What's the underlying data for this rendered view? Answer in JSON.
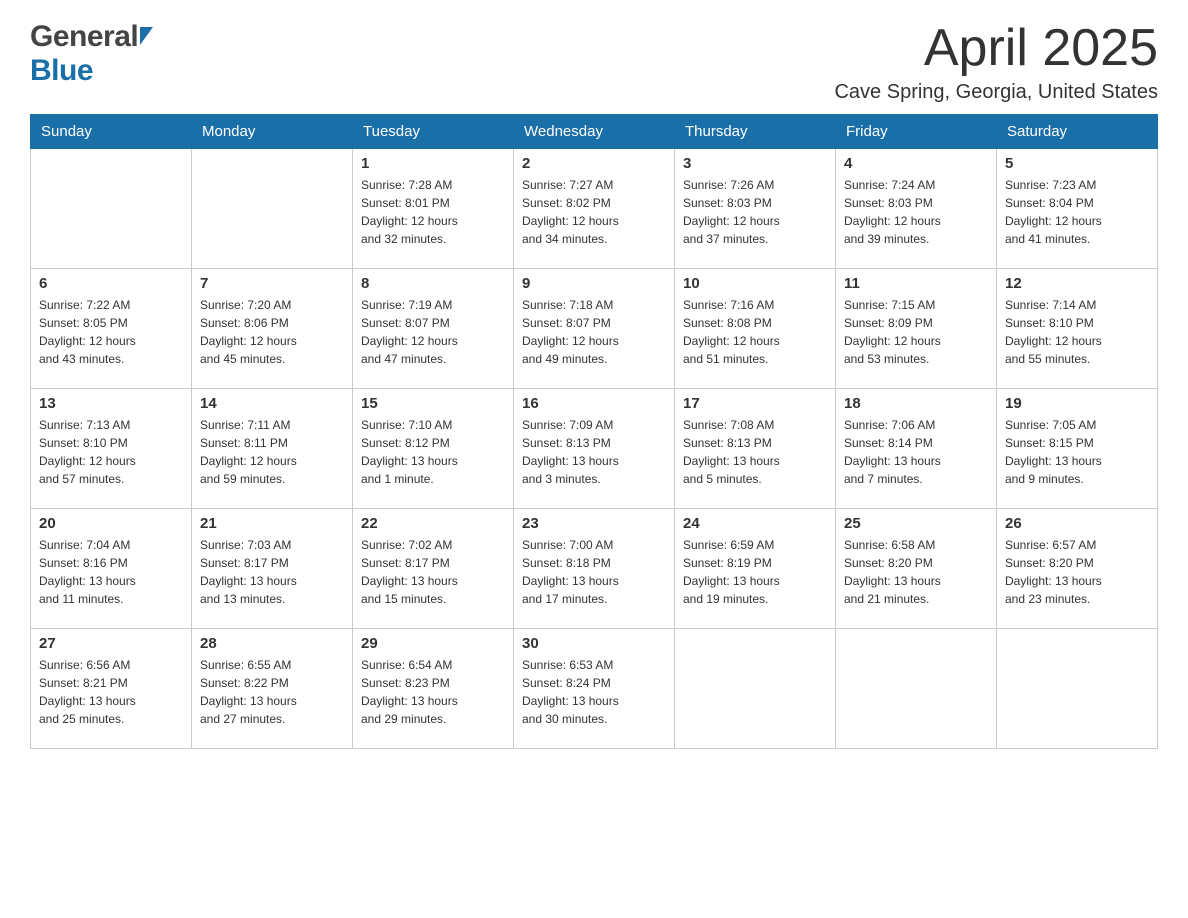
{
  "header": {
    "month_title": "April 2025",
    "location": "Cave Spring, Georgia, United States",
    "logo_general": "General",
    "logo_blue": "Blue"
  },
  "weekdays": [
    "Sunday",
    "Monday",
    "Tuesday",
    "Wednesday",
    "Thursday",
    "Friday",
    "Saturday"
  ],
  "weeks": [
    [
      {
        "day": "",
        "info": ""
      },
      {
        "day": "",
        "info": ""
      },
      {
        "day": "1",
        "info": "Sunrise: 7:28 AM\nSunset: 8:01 PM\nDaylight: 12 hours\nand 32 minutes."
      },
      {
        "day": "2",
        "info": "Sunrise: 7:27 AM\nSunset: 8:02 PM\nDaylight: 12 hours\nand 34 minutes."
      },
      {
        "day": "3",
        "info": "Sunrise: 7:26 AM\nSunset: 8:03 PM\nDaylight: 12 hours\nand 37 minutes."
      },
      {
        "day": "4",
        "info": "Sunrise: 7:24 AM\nSunset: 8:03 PM\nDaylight: 12 hours\nand 39 minutes."
      },
      {
        "day": "5",
        "info": "Sunrise: 7:23 AM\nSunset: 8:04 PM\nDaylight: 12 hours\nand 41 minutes."
      }
    ],
    [
      {
        "day": "6",
        "info": "Sunrise: 7:22 AM\nSunset: 8:05 PM\nDaylight: 12 hours\nand 43 minutes."
      },
      {
        "day": "7",
        "info": "Sunrise: 7:20 AM\nSunset: 8:06 PM\nDaylight: 12 hours\nand 45 minutes."
      },
      {
        "day": "8",
        "info": "Sunrise: 7:19 AM\nSunset: 8:07 PM\nDaylight: 12 hours\nand 47 minutes."
      },
      {
        "day": "9",
        "info": "Sunrise: 7:18 AM\nSunset: 8:07 PM\nDaylight: 12 hours\nand 49 minutes."
      },
      {
        "day": "10",
        "info": "Sunrise: 7:16 AM\nSunset: 8:08 PM\nDaylight: 12 hours\nand 51 minutes."
      },
      {
        "day": "11",
        "info": "Sunrise: 7:15 AM\nSunset: 8:09 PM\nDaylight: 12 hours\nand 53 minutes."
      },
      {
        "day": "12",
        "info": "Sunrise: 7:14 AM\nSunset: 8:10 PM\nDaylight: 12 hours\nand 55 minutes."
      }
    ],
    [
      {
        "day": "13",
        "info": "Sunrise: 7:13 AM\nSunset: 8:10 PM\nDaylight: 12 hours\nand 57 minutes."
      },
      {
        "day": "14",
        "info": "Sunrise: 7:11 AM\nSunset: 8:11 PM\nDaylight: 12 hours\nand 59 minutes."
      },
      {
        "day": "15",
        "info": "Sunrise: 7:10 AM\nSunset: 8:12 PM\nDaylight: 13 hours\nand 1 minute."
      },
      {
        "day": "16",
        "info": "Sunrise: 7:09 AM\nSunset: 8:13 PM\nDaylight: 13 hours\nand 3 minutes."
      },
      {
        "day": "17",
        "info": "Sunrise: 7:08 AM\nSunset: 8:13 PM\nDaylight: 13 hours\nand 5 minutes."
      },
      {
        "day": "18",
        "info": "Sunrise: 7:06 AM\nSunset: 8:14 PM\nDaylight: 13 hours\nand 7 minutes."
      },
      {
        "day": "19",
        "info": "Sunrise: 7:05 AM\nSunset: 8:15 PM\nDaylight: 13 hours\nand 9 minutes."
      }
    ],
    [
      {
        "day": "20",
        "info": "Sunrise: 7:04 AM\nSunset: 8:16 PM\nDaylight: 13 hours\nand 11 minutes."
      },
      {
        "day": "21",
        "info": "Sunrise: 7:03 AM\nSunset: 8:17 PM\nDaylight: 13 hours\nand 13 minutes."
      },
      {
        "day": "22",
        "info": "Sunrise: 7:02 AM\nSunset: 8:17 PM\nDaylight: 13 hours\nand 15 minutes."
      },
      {
        "day": "23",
        "info": "Sunrise: 7:00 AM\nSunset: 8:18 PM\nDaylight: 13 hours\nand 17 minutes."
      },
      {
        "day": "24",
        "info": "Sunrise: 6:59 AM\nSunset: 8:19 PM\nDaylight: 13 hours\nand 19 minutes."
      },
      {
        "day": "25",
        "info": "Sunrise: 6:58 AM\nSunset: 8:20 PM\nDaylight: 13 hours\nand 21 minutes."
      },
      {
        "day": "26",
        "info": "Sunrise: 6:57 AM\nSunset: 8:20 PM\nDaylight: 13 hours\nand 23 minutes."
      }
    ],
    [
      {
        "day": "27",
        "info": "Sunrise: 6:56 AM\nSunset: 8:21 PM\nDaylight: 13 hours\nand 25 minutes."
      },
      {
        "day": "28",
        "info": "Sunrise: 6:55 AM\nSunset: 8:22 PM\nDaylight: 13 hours\nand 27 minutes."
      },
      {
        "day": "29",
        "info": "Sunrise: 6:54 AM\nSunset: 8:23 PM\nDaylight: 13 hours\nand 29 minutes."
      },
      {
        "day": "30",
        "info": "Sunrise: 6:53 AM\nSunset: 8:24 PM\nDaylight: 13 hours\nand 30 minutes."
      },
      {
        "day": "",
        "info": ""
      },
      {
        "day": "",
        "info": ""
      },
      {
        "day": "",
        "info": ""
      }
    ]
  ]
}
